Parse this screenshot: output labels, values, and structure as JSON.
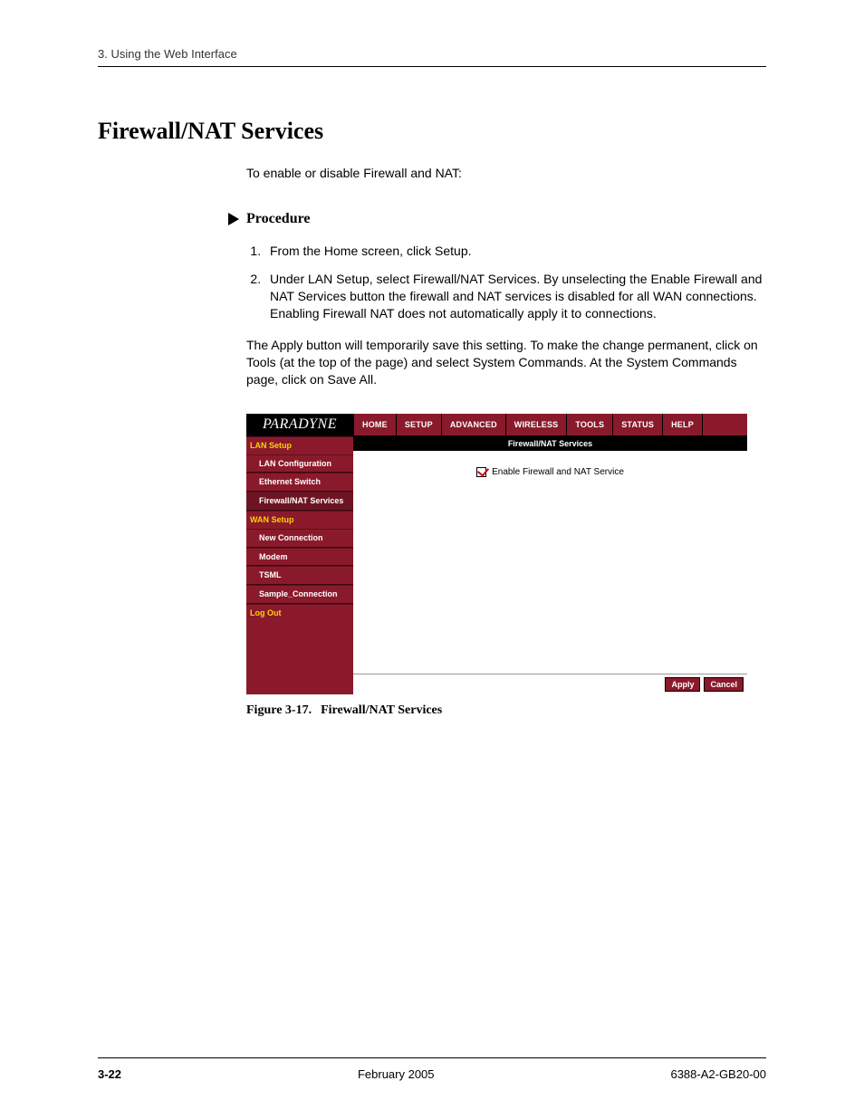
{
  "header": {
    "running": "3. Using the Web Interface"
  },
  "title": "Firewall/NAT Services",
  "intro": "To enable or disable Firewall and NAT:",
  "procedure_label": "Procedure",
  "steps": {
    "s1": "From the Home screen, click Setup.",
    "s2": "Under LAN Setup, select Firewall/NAT Services. By unselecting the Enable Firewall and NAT Services button the firewall and NAT services is disabled for all WAN connections.  Enabling Firewall NAT does not automatically apply it to connections."
  },
  "para_apply": "The Apply button will temporarily save this setting. To make the change permanent, click on Tools (at the top of the page) and select System Commands. At the System Commands page, click on Save All.",
  "app": {
    "brand": "PARADYNE",
    "tabs": [
      "HOME",
      "SETUP",
      "ADVANCED",
      "WIRELESS",
      "TOOLS",
      "STATUS",
      "HELP"
    ],
    "content_title": "Firewall/NAT Services",
    "checkbox_label": "Enable Firewall and NAT Service",
    "apply": "Apply",
    "cancel": "Cancel",
    "sidebar": {
      "lan_setup": "LAN Setup",
      "lan_config": "LAN Configuration",
      "eth_switch": "Ethernet Switch",
      "fw_nat": "Firewall/NAT Services",
      "wan_setup": "WAN Setup",
      "new_conn": "New Connection",
      "modem": "Modem",
      "tsml": "TSML",
      "sample": "Sample_Connection",
      "logout": "Log Out"
    }
  },
  "caption_num": "Figure 3-17.",
  "caption_text": "Firewall/NAT Services",
  "footer": {
    "page": "3-22",
    "date": "February 2005",
    "doc": "6388-A2-GB20-00"
  }
}
